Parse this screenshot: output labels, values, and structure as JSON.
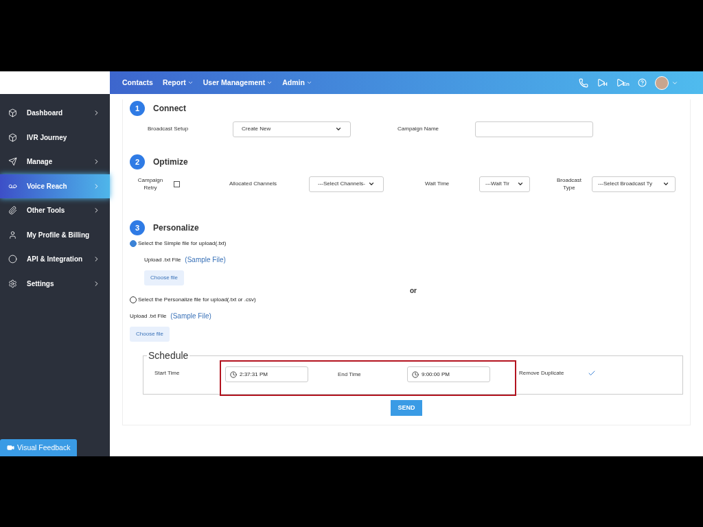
{
  "topnav": {
    "items": [
      {
        "label": "Contacts",
        "dropdown": false
      },
      {
        "label": "Report",
        "dropdown": true
      },
      {
        "label": "User Management",
        "dropdown": true
      },
      {
        "label": "Admin",
        "dropdown": true
      }
    ],
    "tools": [
      {
        "kind": "phone"
      },
      {
        "kind": "play",
        "badge": "H"
      },
      {
        "kind": "play",
        "badge": "En"
      },
      {
        "kind": "help"
      },
      {
        "kind": "avatar"
      }
    ]
  },
  "sidebar": {
    "items": [
      {
        "label": "Dashboard",
        "submenu": true,
        "selected": false
      },
      {
        "label": "IVR Journey",
        "submenu": false,
        "selected": false
      },
      {
        "label": "Manage",
        "submenu": true,
        "selected": false
      },
      {
        "label": "Voice Reach",
        "submenu": true,
        "selected": true
      },
      {
        "label": "Other Tools",
        "submenu": true,
        "selected": false
      },
      {
        "label": "My Profile & Billing",
        "submenu": false,
        "selected": false
      },
      {
        "label": "API & Integration",
        "submenu": true,
        "selected": false
      },
      {
        "label": "Settings",
        "submenu": true,
        "selected": false
      }
    ],
    "feedback_button": "Visual Feedback"
  },
  "connect": {
    "step": "1",
    "title": "Connect",
    "broadcast_setup_label": "Broadcast Setup",
    "broadcast_setup_value": "Create New",
    "campaign_name_label": "Campaign Name"
  },
  "optimize": {
    "step": "2",
    "title": "Optimize",
    "campaign_retry_label": "Campaign Retry",
    "campaign_retry_checked": false,
    "allocated_channels_label": "Allocated Channels",
    "allocated_channels_value": "---Select Channels-",
    "wait_time_label": "Wait Time",
    "wait_time_value": "---Wait Tir",
    "broadcast_type_label": "Broadcast Type",
    "broadcast_type_value": "---Select Broadcast Ty"
  },
  "personalize": {
    "step": "3",
    "title": "Personalize",
    "options": [
      {
        "label": "Select the Simple file for upload(.txt)",
        "selected": true,
        "upload_label": "Upload .txt File",
        "sample_link": "(Sample File)",
        "choose_button": "Choose file"
      },
      {
        "label": "Select the Personalize file for upload(.txt or .csv)",
        "selected": false,
        "upload_label": "Upload .txt File",
        "sample_link": "(Sample File)",
        "choose_button": "Choose file"
      }
    ],
    "or": "or"
  },
  "schedule": {
    "title": "Schedule",
    "start_label": "Start Time",
    "start_value": "2:37:31 PM",
    "end_label": "End Time",
    "end_value": "9:00:00 PM",
    "remove_duplicate_label": "Remove Duplicate",
    "remove_duplicate_checked": true
  },
  "send_button": "SEND"
}
